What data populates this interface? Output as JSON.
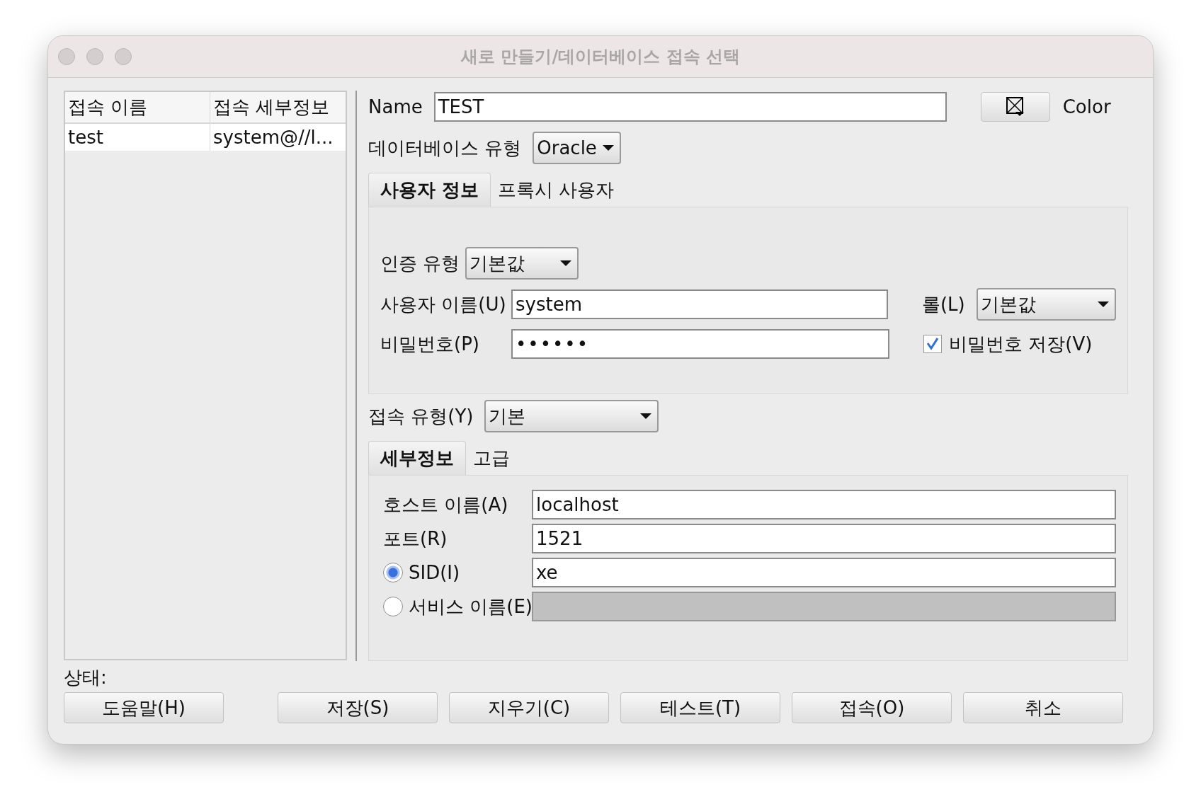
{
  "window": {
    "title": "새로 만들기/데이터베이스 접속 선택"
  },
  "connections": {
    "columns": [
      "접속 이름",
      "접속 세부정보"
    ],
    "rows": [
      {
        "cells": [
          "test",
          "system@//l..."
        ]
      }
    ]
  },
  "status": {
    "label": "상태:"
  },
  "name": {
    "label": "Name",
    "value": "TEST"
  },
  "color": {
    "label": "Color"
  },
  "database_type": {
    "label": "데이터베이스 유형",
    "value": "Oracle"
  },
  "user_tabs": [
    {
      "label": "사용자 정보",
      "selected": true
    },
    {
      "label": "프록시 사용자",
      "selected": false
    }
  ],
  "auth_type": {
    "label": "인증 유형",
    "value": "기본값"
  },
  "username": {
    "label": "사용자 이름(U)",
    "value": "system"
  },
  "role": {
    "label": "롤(L)",
    "value": "기본값"
  },
  "password": {
    "label": "비밀번호(P)",
    "value": "••••••"
  },
  "save_password": {
    "label": "비밀번호 저장(V)",
    "checked": true
  },
  "connection_type": {
    "label": "접속 유형(Y)",
    "value": "기본"
  },
  "detail_tabs": [
    {
      "label": "세부정보",
      "selected": true
    },
    {
      "label": "고급",
      "selected": false
    }
  ],
  "hostname": {
    "label": "호스트 이름(A)",
    "value": "localhost"
  },
  "port": {
    "label": "포트(R)",
    "value": "1521"
  },
  "sid_options": [
    {
      "label": "SID(I)",
      "selected": true,
      "value": "xe",
      "disabled": false
    },
    {
      "label": "서비스 이름(E)",
      "selected": false,
      "disabled": true
    }
  ],
  "buttons": [
    {
      "label": "도움말(H)",
      "kind": "help"
    },
    {
      "label": "저장(S)",
      "kind": "action"
    },
    {
      "label": "지우기(C)",
      "kind": "action"
    },
    {
      "label": "테스트(T)",
      "kind": "action"
    },
    {
      "label": "접속(O)",
      "kind": "action"
    },
    {
      "label": "취소",
      "kind": "action"
    }
  ]
}
